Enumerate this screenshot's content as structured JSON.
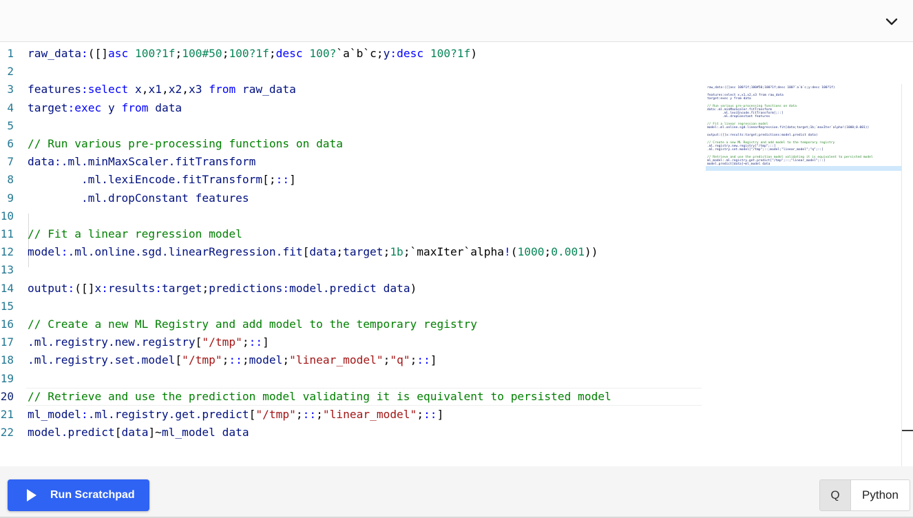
{
  "header": {
    "collapse_icon": "chevron-down-icon"
  },
  "editor": {
    "active_line": 20,
    "lines": [
      {
        "n": "1",
        "tokens": [
          {
            "t": "raw_data",
            "c": "v"
          },
          {
            "t": ":",
            "c": "k"
          },
          {
            "t": "([]",
            "c": "p"
          },
          {
            "t": "asc",
            "c": "k"
          },
          {
            "t": " ",
            "c": "p"
          },
          {
            "t": "100?1f",
            "c": "n"
          },
          {
            "t": ";",
            "c": "p"
          },
          {
            "t": "100#50",
            "c": "n"
          },
          {
            "t": ";",
            "c": "p"
          },
          {
            "t": "100?1f",
            "c": "n"
          },
          {
            "t": ";",
            "c": "p"
          },
          {
            "t": "desc",
            "c": "k"
          },
          {
            "t": " ",
            "c": "p"
          },
          {
            "t": "100?",
            "c": "n"
          },
          {
            "t": "`a`b`c",
            "c": "p"
          },
          {
            "t": ";",
            "c": "p"
          },
          {
            "t": "y",
            "c": "v"
          },
          {
            "t": ":",
            "c": "k"
          },
          {
            "t": "desc",
            "c": "k"
          },
          {
            "t": " ",
            "c": "p"
          },
          {
            "t": "100?1f",
            "c": "n"
          },
          {
            "t": ")",
            "c": "p"
          }
        ]
      },
      {
        "n": "2",
        "tokens": []
      },
      {
        "n": "3",
        "tokens": [
          {
            "t": "features",
            "c": "v"
          },
          {
            "t": ":",
            "c": "k"
          },
          {
            "t": "select",
            "c": "k"
          },
          {
            "t": " x",
            "c": "v"
          },
          {
            "t": ",",
            "c": "p"
          },
          {
            "t": "x1",
            "c": "v"
          },
          {
            "t": ",",
            "c": "p"
          },
          {
            "t": "x2",
            "c": "v"
          },
          {
            "t": ",",
            "c": "p"
          },
          {
            "t": "x3 ",
            "c": "v"
          },
          {
            "t": "from",
            "c": "k"
          },
          {
            "t": " raw_data",
            "c": "v"
          }
        ]
      },
      {
        "n": "4",
        "tokens": [
          {
            "t": "target",
            "c": "v"
          },
          {
            "t": ":",
            "c": "k"
          },
          {
            "t": "exec",
            "c": "k"
          },
          {
            "t": " y ",
            "c": "v"
          },
          {
            "t": "from",
            "c": "k"
          },
          {
            "t": " data",
            "c": "v"
          }
        ]
      },
      {
        "n": "5",
        "tokens": []
      },
      {
        "n": "6",
        "tokens": [
          {
            "t": "// Run various pre-processing functions on data",
            "c": "c"
          }
        ]
      },
      {
        "n": "7",
        "tokens": [
          {
            "t": "data",
            "c": "v"
          },
          {
            "t": ":",
            "c": "k"
          },
          {
            "t": ".ml.minMaxScaler.fitTransform",
            "c": "v"
          }
        ]
      },
      {
        "n": "8",
        "tokens": [
          {
            "t": "        .ml.lexiEncode.fitTransform",
            "c": "v"
          },
          {
            "t": "[;",
            "c": "p"
          },
          {
            "t": "::",
            "c": "k"
          },
          {
            "t": "]",
            "c": "p"
          }
        ]
      },
      {
        "n": "9",
        "tokens": [
          {
            "t": "        .ml.dropConstant features",
            "c": "v"
          }
        ]
      },
      {
        "n": "10",
        "tokens": []
      },
      {
        "n": "11",
        "tokens": [
          {
            "t": "// Fit a linear regression model",
            "c": "c"
          }
        ]
      },
      {
        "n": "12",
        "tokens": [
          {
            "t": "model",
            "c": "v"
          },
          {
            "t": ":",
            "c": "k"
          },
          {
            "t": ".ml.online.sgd.linearRegression.fit",
            "c": "v"
          },
          {
            "t": "[",
            "c": "p"
          },
          {
            "t": "data",
            "c": "v"
          },
          {
            "t": ";",
            "c": "p"
          },
          {
            "t": "target",
            "c": "v"
          },
          {
            "t": ";",
            "c": "p"
          },
          {
            "t": "1b",
            "c": "n"
          },
          {
            "t": ";`maxIter`alpha",
            "c": "p"
          },
          {
            "t": "!",
            "c": "k"
          },
          {
            "t": "(",
            "c": "p"
          },
          {
            "t": "1000",
            "c": "n"
          },
          {
            "t": ";",
            "c": "p"
          },
          {
            "t": "0.001",
            "c": "n"
          },
          {
            "t": "))",
            "c": "p"
          }
        ]
      },
      {
        "n": "13",
        "tokens": []
      },
      {
        "n": "14",
        "tokens": [
          {
            "t": "output",
            "c": "v"
          },
          {
            "t": ":",
            "c": "k"
          },
          {
            "t": "([]",
            "c": "p"
          },
          {
            "t": "x",
            "c": "v"
          },
          {
            "t": ":",
            "c": "k"
          },
          {
            "t": "results",
            "c": "v"
          },
          {
            "t": ":",
            "c": "k"
          },
          {
            "t": "target",
            "c": "v"
          },
          {
            "t": ";",
            "c": "p"
          },
          {
            "t": "predictions",
            "c": "v"
          },
          {
            "t": ":",
            "c": "k"
          },
          {
            "t": "model.predict data",
            "c": "v"
          },
          {
            "t": ")",
            "c": "p"
          }
        ]
      },
      {
        "n": "15",
        "tokens": []
      },
      {
        "n": "16",
        "tokens": [
          {
            "t": "// Create a new ML Registry and add model to the temporary registry",
            "c": "c"
          }
        ]
      },
      {
        "n": "17",
        "tokens": [
          {
            "t": ".ml.registry.new.registry",
            "c": "v"
          },
          {
            "t": "[",
            "c": "p"
          },
          {
            "t": "\"/tmp\"",
            "c": "s"
          },
          {
            "t": ";",
            "c": "p"
          },
          {
            "t": "::",
            "c": "k"
          },
          {
            "t": "]",
            "c": "p"
          }
        ]
      },
      {
        "n": "18",
        "tokens": [
          {
            "t": ".ml.registry.set.model",
            "c": "v"
          },
          {
            "t": "[",
            "c": "p"
          },
          {
            "t": "\"/tmp\"",
            "c": "s"
          },
          {
            "t": ";",
            "c": "p"
          },
          {
            "t": "::",
            "c": "k"
          },
          {
            "t": ";",
            "c": "p"
          },
          {
            "t": "model",
            "c": "v"
          },
          {
            "t": ";",
            "c": "p"
          },
          {
            "t": "\"linear_model\"",
            "c": "s"
          },
          {
            "t": ";",
            "c": "p"
          },
          {
            "t": "\"q\"",
            "c": "s"
          },
          {
            "t": ";",
            "c": "p"
          },
          {
            "t": "::",
            "c": "k"
          },
          {
            "t": "]",
            "c": "p"
          }
        ]
      },
      {
        "n": "19",
        "tokens": []
      },
      {
        "n": "20",
        "tokens": [
          {
            "t": "// Retrieve and use the prediction model validating it is equivalent to persisted model",
            "c": "c"
          }
        ]
      },
      {
        "n": "21",
        "tokens": [
          {
            "t": "ml_model",
            "c": "v"
          },
          {
            "t": ":",
            "c": "k"
          },
          {
            "t": ".ml.registry.get.predict",
            "c": "v"
          },
          {
            "t": "[",
            "c": "p"
          },
          {
            "t": "\"/tmp\"",
            "c": "s"
          },
          {
            "t": ";",
            "c": "p"
          },
          {
            "t": "::",
            "c": "k"
          },
          {
            "t": ";",
            "c": "p"
          },
          {
            "t": "\"linear_model\"",
            "c": "s"
          },
          {
            "t": ";",
            "c": "p"
          },
          {
            "t": "::",
            "c": "k"
          },
          {
            "t": "]",
            "c": "p"
          }
        ]
      },
      {
        "n": "22",
        "tokens": [
          {
            "t": "model.predict",
            "c": "v"
          },
          {
            "t": "[",
            "c": "p"
          },
          {
            "t": "data",
            "c": "v"
          },
          {
            "t": "]~",
            "c": "p"
          },
          {
            "t": "ml_model data",
            "c": "v"
          }
        ]
      }
    ]
  },
  "footer": {
    "run_label": "Run Scratchpad",
    "run_icon": "play-icon",
    "lang_q": "Q",
    "lang_python": "Python",
    "selected_language": "Q"
  }
}
